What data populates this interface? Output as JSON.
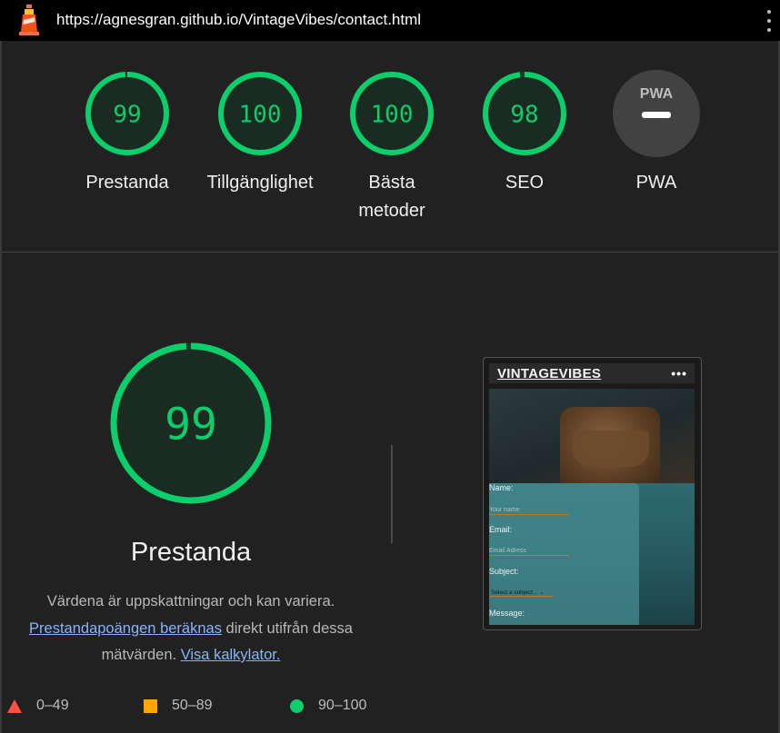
{
  "browser": {
    "url": "https://agnesgran.github.io/VintageVibes/contact.html"
  },
  "categories": [
    {
      "score": "99",
      "label": "Prestanda",
      "fraction": 0.99,
      "type": "score"
    },
    {
      "score": "100",
      "label": "Tillgänglighet",
      "fraction": 1.0,
      "type": "score"
    },
    {
      "score": "100",
      "label": "Bästa metoder",
      "fraction": 1.0,
      "type": "score"
    },
    {
      "score": "98",
      "label": "SEO",
      "fraction": 0.98,
      "type": "score"
    },
    {
      "score": "",
      "label": "PWA",
      "fraction": 0,
      "type": "pwa"
    }
  ],
  "pwa_badge_text": "PWA",
  "performance": {
    "score": "99",
    "fraction": 0.99,
    "title": "Prestanda",
    "desc_part1": "Värdena är uppskattningar och kan variera.",
    "desc_link1": "Prestandapoängen beräknas",
    "desc_part2": " direkt utifrån dessa mätvärden. ",
    "desc_link2": "Visa kalkylator."
  },
  "legend": [
    {
      "shape": "triangle",
      "range": "0–49",
      "color": "#ff4e42"
    },
    {
      "shape": "square",
      "range": "50–89",
      "color": "#ffa400"
    },
    {
      "shape": "circle",
      "range": "90–100",
      "color": "#0cce6b"
    }
  ],
  "screenshot": {
    "brand": "VINTAGEVIBES",
    "menu_icon": "•••",
    "name_label": "Name:",
    "name_placeholder": "Your name",
    "email_label": "Email:",
    "email_placeholder": "Email Adress",
    "subject_label": "Subject:",
    "subject_select": "Select a subject... ⌄",
    "message_label": "Message:"
  },
  "colors": {
    "pass": "#0cce6b",
    "pass_fill": "#1a2b22",
    "topbar": "#000000",
    "background": "#212121",
    "link": "#8ab4f8"
  }
}
